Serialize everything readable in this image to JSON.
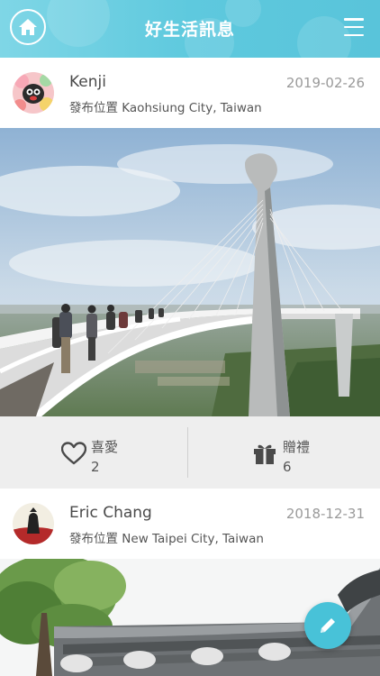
{
  "header": {
    "title": "好生活訊息"
  },
  "posts": [
    {
      "user": "Kenji",
      "date": "2019-02-26",
      "location": "發布位置 Kaohsiung City, Taiwan",
      "like_label": "喜愛",
      "like_count": "2",
      "gift_label": "贈禮",
      "gift_count": "6"
    },
    {
      "user": "Eric Chang",
      "date": "2018-12-31",
      "location": "發布位置 New Taipei City, Taiwan"
    }
  ],
  "colors": {
    "header": "#5ec9de",
    "fab": "#48c2d8"
  },
  "icons": {
    "home": "home-icon",
    "menu": "menu-icon",
    "like": "heart-icon",
    "gift": "gift-icon",
    "compose": "pencil-icon"
  }
}
